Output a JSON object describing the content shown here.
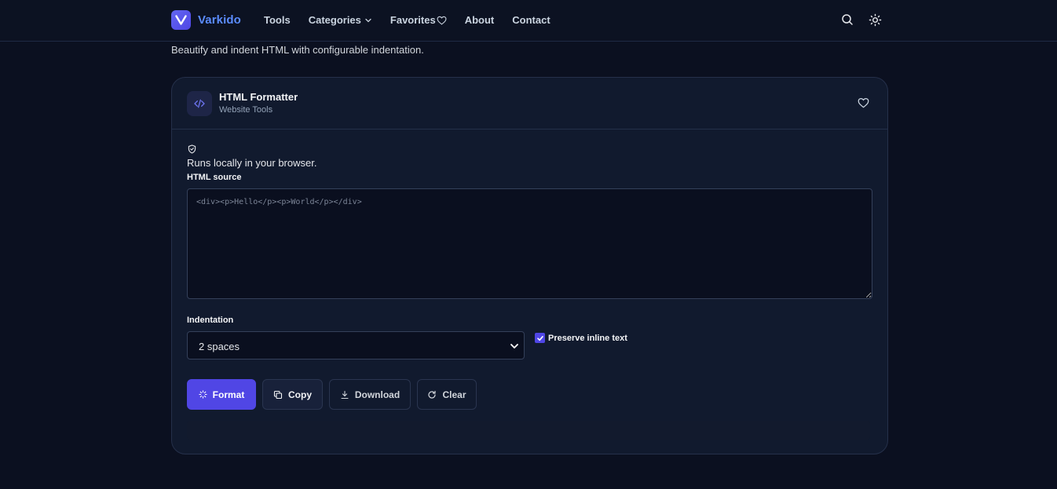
{
  "nav": {
    "brand": "Varkido",
    "links": [
      {
        "label": "Tools"
      },
      {
        "label": "Categories"
      },
      {
        "label": "Favorites"
      },
      {
        "label": "About"
      },
      {
        "label": "Contact"
      }
    ]
  },
  "page": {
    "subtitle": "Beautify and indent HTML with configurable indentation."
  },
  "tool": {
    "title": "HTML Formatter",
    "category": "Website Tools",
    "local_note": "Runs locally in your browser.",
    "source_label": "HTML source",
    "source_placeholder": "<div><p>Hello</p><p>World</p></div>",
    "source_value": "",
    "indent_label": "Indentation",
    "indent_value": "2 spaces",
    "preserve_label": "Preserve inline text",
    "preserve_checked": true
  },
  "actions": {
    "format": "Format",
    "copy": "Copy",
    "download": "Download",
    "clear": "Clear"
  },
  "colors": {
    "background": "#0b1020",
    "card": "#111a2e",
    "accent": "#5046e5",
    "brand_text": "#5b8cff"
  }
}
